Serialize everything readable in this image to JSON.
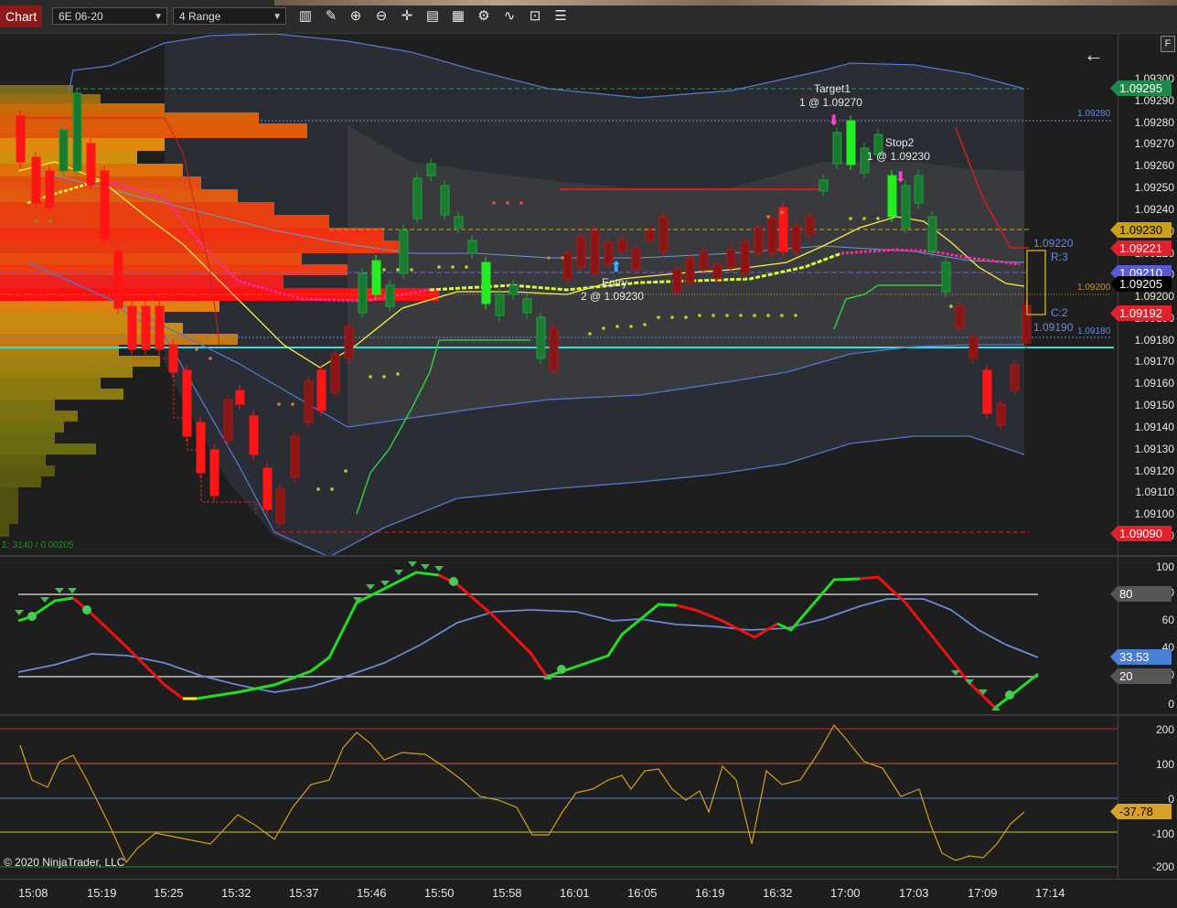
{
  "toolbar": {
    "tab_label": "Chart",
    "instrument": "6E 06-20",
    "bar_type": "4 Range",
    "icons": [
      "bar-type-icon",
      "draw-pencil-icon",
      "zoom-in-icon",
      "zoom-out-icon",
      "crosshair-icon",
      "data-box-icon",
      "strategies-icon",
      "indicators-icon",
      "templates-icon",
      "properties-icon"
    ]
  },
  "price_panel": {
    "f_button": "F",
    "back_arrow": "←",
    "ticks": [
      "1.09300",
      "1.09290",
      "1.09280",
      "1.09270",
      "1.09260",
      "1.09250",
      "1.09240",
      "1.09230",
      "1.09220",
      "1.09210",
      "1.09200",
      "1.09190",
      "1.09180",
      "1.09170",
      "1.09160",
      "1.09150",
      "1.09140",
      "1.09130",
      "1.09120",
      "1.09110",
      "1.09100",
      "1.09090"
    ],
    "tags": [
      {
        "text": "1.09295",
        "bg": "#1e8a4a",
        "fg": "#ffffff"
      },
      {
        "text": "1.09230",
        "bg": "#c9a21a",
        "fg": "#000000"
      },
      {
        "text": "1.09221",
        "bg": "#e0202a",
        "fg": "#ffffff"
      },
      {
        "text": "1.09210",
        "bg": "#5a5ad8",
        "fg": "#ffffff"
      },
      {
        "text": "1.09205",
        "bg": "#000000",
        "fg": "#ffffff"
      },
      {
        "text": "1.09192",
        "bg": "#e0202a",
        "fg": "#ffffff"
      },
      {
        "text": "1.09090",
        "bg": "#e0202a",
        "fg": "#ffffff"
      }
    ],
    "level_labels": {
      "l1": "1.09280",
      "l2": "1.09200",
      "l3": "1.09180",
      "l4": "1.09220",
      "l5": "1.09190"
    },
    "range_labels": {
      "r": "R:3",
      "c": "C:2"
    },
    "orders": {
      "target_title": "Target1",
      "target_detail": "1 @ 1.09270",
      "stop_title": "Stop2",
      "stop_detail": "1 @ 1.09230",
      "entry_title": "Entry",
      "entry_detail": "2 @ 1.09230"
    },
    "volume_label": "Σ: 3140 / 0.00205"
  },
  "stoch_panel": {
    "ticks": [
      "100",
      "80",
      "60",
      "40",
      "20",
      "0"
    ],
    "tags": [
      {
        "text": "80",
        "bg": "#555555",
        "fg": "#ffffff"
      },
      {
        "text": "33.53",
        "bg": "#4a7fd6",
        "fg": "#ffffff"
      },
      {
        "text": "20",
        "bg": "#555555",
        "fg": "#ffffff"
      }
    ]
  },
  "cci_panel": {
    "ticks": [
      "200",
      "100",
      "0",
      "-100",
      "-200"
    ],
    "tags": [
      {
        "text": "-37.78",
        "bg": "#d6a22a",
        "fg": "#000000"
      }
    ],
    "copyright": "© 2020 NinjaTrader, LLC"
  },
  "time_axis": [
    "15:08",
    "15:19",
    "15:25",
    "15:32",
    "15:37",
    "15:46",
    "15:50",
    "15:58",
    "16:01",
    "16:05",
    "16:19",
    "16:32",
    "17:00",
    "17:03",
    "17:09",
    "17:14"
  ],
  "colors": {
    "up": "#22dd22",
    "down": "#ee1111",
    "ma": "#ffee44",
    "bands": "#5577cc",
    "cci": "#d4a020"
  }
}
